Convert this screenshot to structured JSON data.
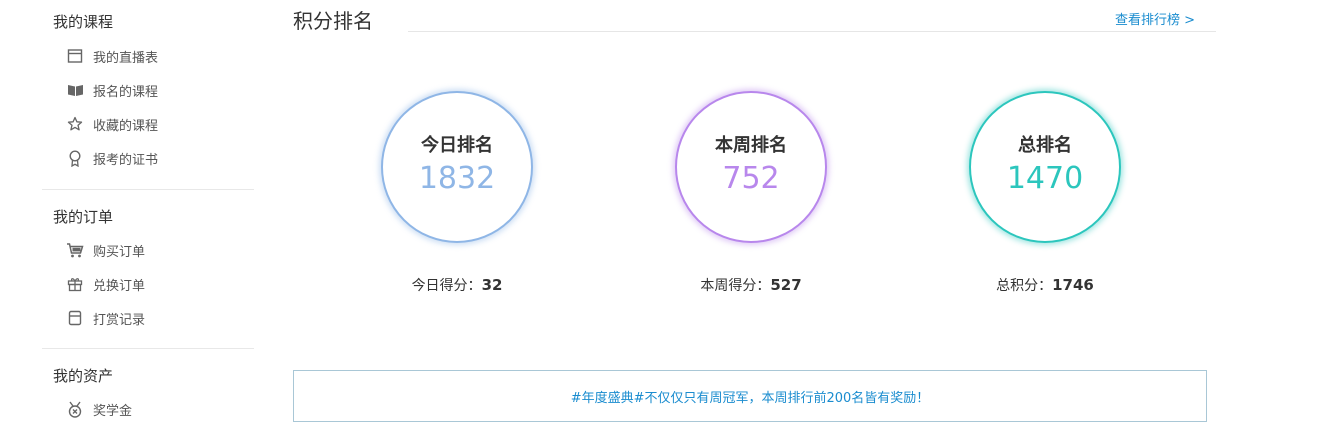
{
  "sidebar": {
    "groups": [
      {
        "title": "我的课程",
        "items": [
          {
            "label": "我的直播表",
            "icon": "calendar-icon"
          },
          {
            "label": "报名的课程",
            "icon": "book-icon"
          },
          {
            "label": "收藏的课程",
            "icon": "star-icon"
          },
          {
            "label": "报考的证书",
            "icon": "award-icon"
          }
        ]
      },
      {
        "title": "我的订单",
        "items": [
          {
            "label": "购买订单",
            "icon": "cart-icon"
          },
          {
            "label": "兑换订单",
            "icon": "gift-icon"
          },
          {
            "label": "打赏记录",
            "icon": "box-icon"
          }
        ]
      },
      {
        "title": "我的资产",
        "items": [
          {
            "label": "奖学金",
            "icon": "medal-icon"
          }
        ]
      }
    ]
  },
  "main": {
    "title": "积分排名",
    "rank_link": "查看排行榜 >",
    "cards": [
      {
        "label": "今日排名",
        "value": "1832",
        "score_label": "今日得分：",
        "score": "32",
        "color": "#8fb6e6"
      },
      {
        "label": "本周排名",
        "value": "752",
        "score_label": "本周得分：",
        "score": "527",
        "color": "#b887ec"
      },
      {
        "label": "总排名",
        "value": "1470",
        "score_label": "总积分：",
        "score": "1746",
        "color": "#2cc6bd"
      }
    ],
    "banner": "#年度盛典#不仅仅只有周冠军，本周排行前200名皆有奖励！"
  }
}
